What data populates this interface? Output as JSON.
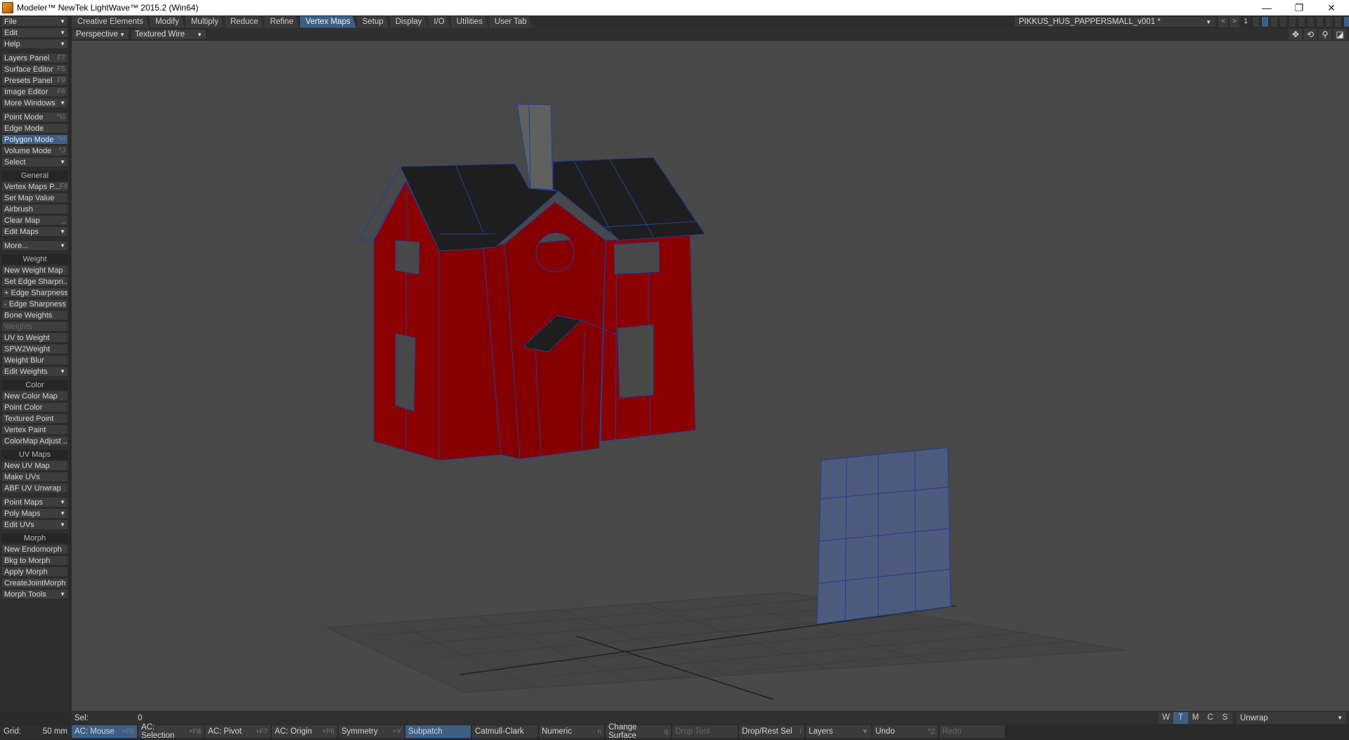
{
  "window": {
    "title": "Modeler™ NewTek LightWave™ 2015.2 (Win64)",
    "minimize": "—",
    "restore": "❐",
    "close": "✕"
  },
  "sidebar": {
    "groups": [
      {
        "header": null,
        "items": [
          {
            "label": "File",
            "dropdown": true
          },
          {
            "label": "Edit",
            "dropdown": true
          },
          {
            "label": "Help",
            "dropdown": true
          }
        ]
      },
      {
        "header": null,
        "items": [
          {
            "label": "Layers Panel",
            "shortcut": "F7"
          },
          {
            "label": "Surface Editor",
            "shortcut": "F5"
          },
          {
            "label": "Presets Panel",
            "shortcut": "F9"
          },
          {
            "label": "Image Editor",
            "shortcut": "F6"
          },
          {
            "label": "More Windows",
            "dropdown": true
          }
        ]
      },
      {
        "header": null,
        "items": [
          {
            "label": "Point Mode",
            "shortcut": "^G"
          },
          {
            "label": "Edge Mode"
          },
          {
            "label": "Polygon Mode",
            "shortcut": "^H",
            "active": true
          },
          {
            "label": "Volume Mode",
            "shortcut": "^J"
          },
          {
            "label": "Select",
            "dropdown": true
          }
        ]
      },
      {
        "header": "General",
        "items": [
          {
            "label": "Vertex Maps P...",
            "shortcut": "F8"
          },
          {
            "label": "Set Map Value"
          },
          {
            "label": "Airbrush"
          },
          {
            "label": "Clear Map",
            "shortcut": "_"
          },
          {
            "label": "Edit Maps",
            "dropdown": true
          }
        ]
      },
      {
        "header": null,
        "items": [
          {
            "label": "More...",
            "dropdown": true
          }
        ]
      },
      {
        "header": "Weight",
        "items": [
          {
            "label": "New Weight Map"
          },
          {
            "label": "Set Edge Sharpn..."
          },
          {
            "label": "+ Edge Sharpness"
          },
          {
            "label": "- Edge Sharpness"
          },
          {
            "label": "Bone Weights"
          },
          {
            "label": "Weights",
            "disabled": true
          },
          {
            "label": "UV to Weight"
          },
          {
            "label": "SPW2Weight"
          },
          {
            "label": "Weight Blur"
          },
          {
            "label": "Edit Weights",
            "dropdown": true
          }
        ]
      },
      {
        "header": "Color",
        "items": [
          {
            "label": "New Color Map"
          },
          {
            "label": "Point Color"
          },
          {
            "label": "Textured Point"
          },
          {
            "label": "Vertex Paint"
          },
          {
            "label": "ColorMap Adjust ..."
          }
        ]
      },
      {
        "header": "UV Maps",
        "items": [
          {
            "label": "New UV Map"
          },
          {
            "label": "Make UVs"
          },
          {
            "label": "ABF UV Unwrap"
          }
        ]
      },
      {
        "header": null,
        "items": [
          {
            "label": "Point Maps",
            "dropdown": true
          },
          {
            "label": "Poly Maps",
            "dropdown": true
          },
          {
            "label": "Edit UVs",
            "dropdown": true
          }
        ]
      },
      {
        "header": "Morph",
        "items": [
          {
            "label": "New Endomorph"
          },
          {
            "label": "Bkg to Morph"
          },
          {
            "label": "Apply Morph"
          },
          {
            "label": "CreateJointMorph"
          },
          {
            "label": "Morph Tools",
            "dropdown": true
          }
        ]
      }
    ]
  },
  "tabs": [
    {
      "label": "Creative Elements"
    },
    {
      "label": "Modify"
    },
    {
      "label": "Multiply"
    },
    {
      "label": "Reduce"
    },
    {
      "label": "Refine"
    },
    {
      "label": "Vertex Maps",
      "active": true
    },
    {
      "label": "Setup"
    },
    {
      "label": "Display"
    },
    {
      "label": "I/O"
    },
    {
      "label": "Utilities"
    },
    {
      "label": "User Tab"
    }
  ],
  "viewport": {
    "view": "Perspective",
    "render_mode": "Textured Wire"
  },
  "object": {
    "name": "PIKKUS_HUS_PAPPERSMALL_v001 *",
    "layer_page": "1",
    "layers_on": [
      2,
      11
    ]
  },
  "selection": {
    "label": "Sel:",
    "count": "0"
  },
  "grid": {
    "label": "Grid:",
    "value": "50 mm"
  },
  "bottom_buttons": [
    {
      "label": "AC: Mouse",
      "shortcut": "+F5",
      "active": true
    },
    {
      "label": "AC: Selection",
      "shortcut": "+F8"
    },
    {
      "label": "AC: Pivot",
      "shortcut": "+F7"
    },
    {
      "label": "AC: Origin",
      "shortcut": "+F6"
    },
    {
      "label": "Symmetry",
      "shortcut": "+Y"
    },
    {
      "label": "Subpatch",
      "shortcut": "",
      "active": true
    },
    {
      "label": "Catmull-Clark",
      "shortcut": ""
    },
    {
      "label": "Numeric",
      "shortcut": "n"
    },
    {
      "label": "Change Surface",
      "shortcut": "q"
    },
    {
      "label": "Drop Tool",
      "shortcut": "",
      "disabled": true
    },
    {
      "label": "Drop/Rest Sel",
      "shortcut": "/"
    },
    {
      "label": "Layers",
      "shortcut": "▼"
    },
    {
      "label": "Undo",
      "shortcut": "^Z"
    },
    {
      "label": "Redo",
      "shortcut": "",
      "disabled": true
    }
  ],
  "display_modes": [
    {
      "label": "W"
    },
    {
      "label": "T",
      "active": true
    },
    {
      "label": "M"
    },
    {
      "label": "C"
    },
    {
      "label": "S"
    }
  ],
  "uv_map": {
    "value": "Unwrap"
  },
  "colors": {
    "accent": "#3d5f86",
    "wall": "#8b0000",
    "roof": "#1e1e1e",
    "wire": "#1e3f9a",
    "viewport": "#484848",
    "uv_plane": "#4e5a7c"
  },
  "icons": {
    "move": "move-icon",
    "rotate": "rotate-view-icon",
    "zoom": "zoom-icon",
    "maximize": "maximize-viewport-icon"
  }
}
